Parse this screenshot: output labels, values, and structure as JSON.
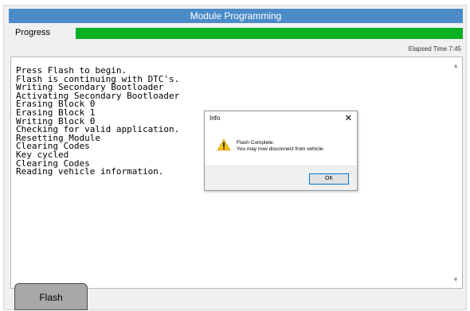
{
  "window": {
    "title": "Module Programming"
  },
  "progress": {
    "label": "Progress",
    "value_fraction": 1.0,
    "fill_color": "#06b025"
  },
  "elapsed": {
    "text": "Elapsed Time 7:45"
  },
  "log": {
    "lines": [
      "Press Flash to begin.",
      "Flash is continuing with DTC's.",
      "Writing Secondary Bootloader",
      "Activating Secondary Bootloader",
      "Erasing Block 0",
      "Erasing Block 1",
      "Writing Block 0",
      "Checking for valid application.",
      "Resetting Module",
      "Clearing Codes",
      "Key cycled",
      "Clearing Codes",
      "Reading vehicle information."
    ],
    "scroll_up_icon": "triangle-up",
    "scroll_down_icon": "triangle-down"
  },
  "toolbar": {
    "flash_label": "Flash"
  },
  "dialog": {
    "title": "Info",
    "close_icon": "close-x",
    "icon": "warning-icon",
    "message_line1": "Flash Complete.",
    "message_line2": "You may now disconnect from vehicle.",
    "ok_label": "OK"
  },
  "colors": {
    "title_bar": "#4a8bc8",
    "accent_border": "#0078d7",
    "warning": "#f6c413"
  }
}
